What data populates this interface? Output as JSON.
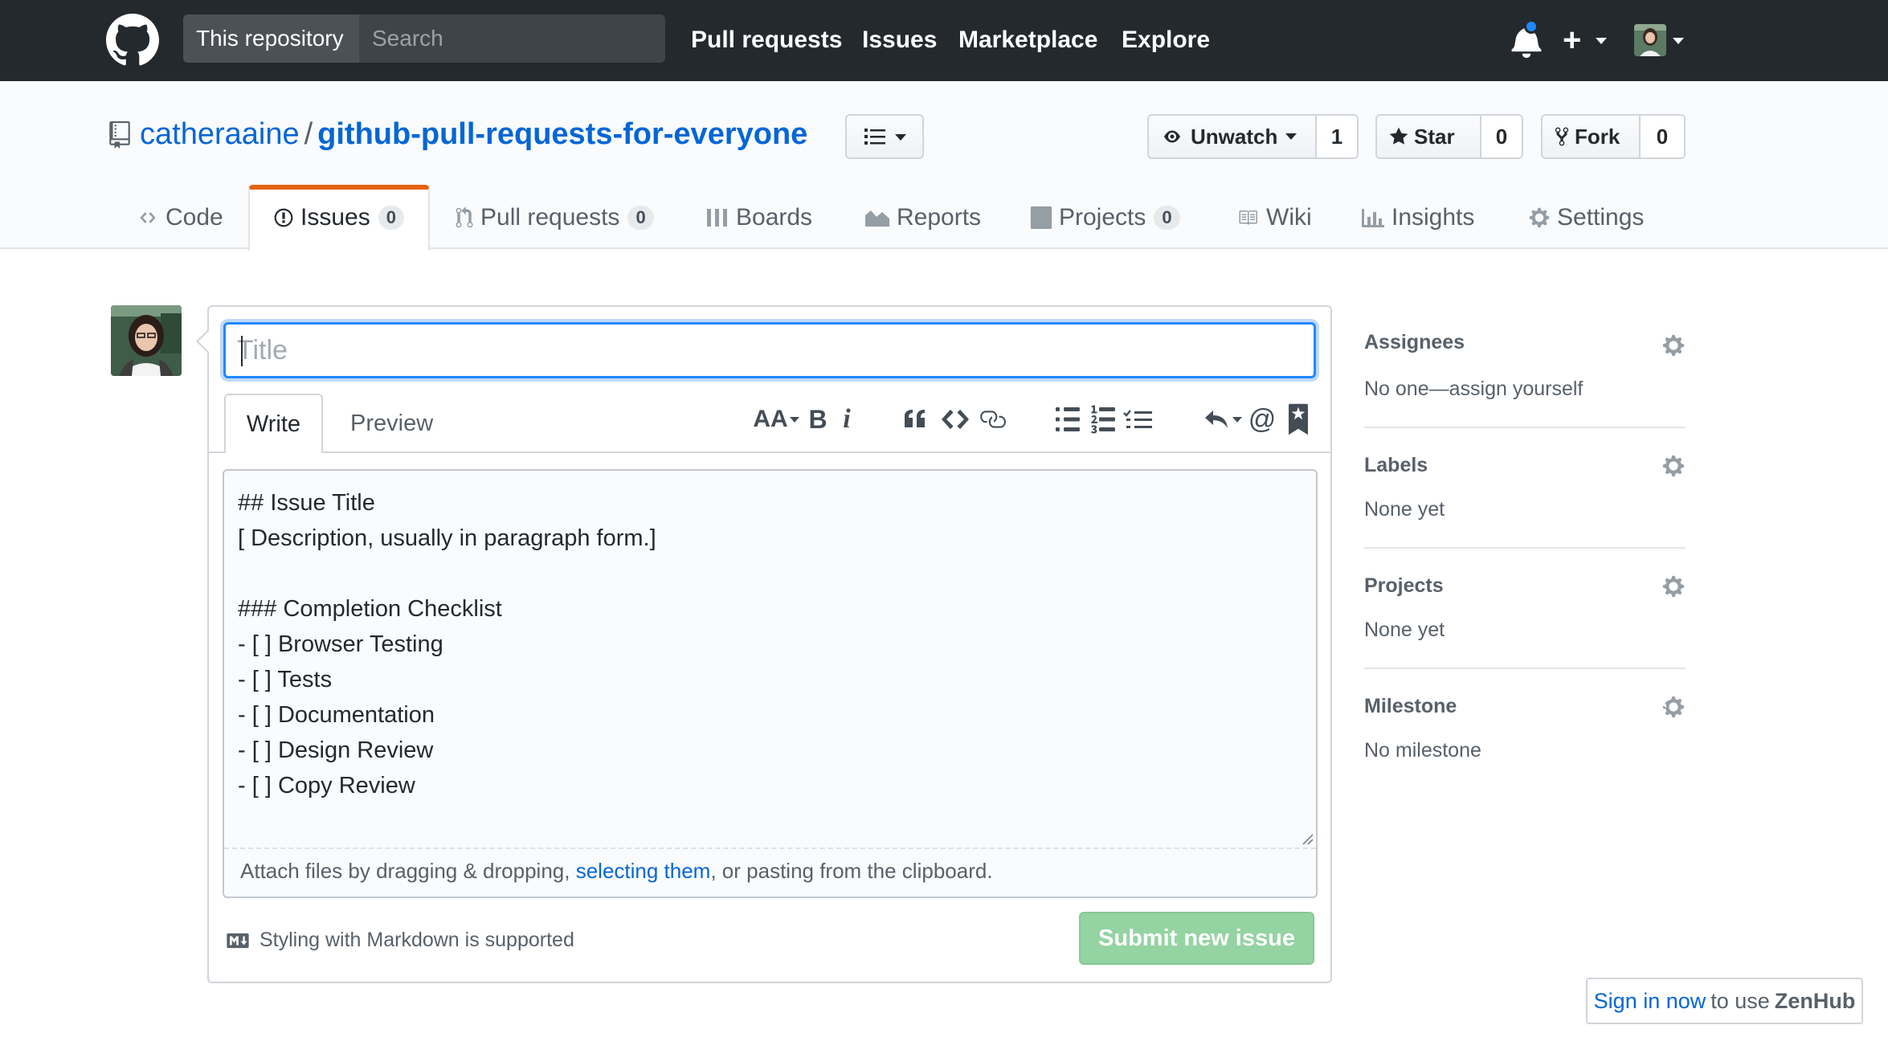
{
  "header": {
    "search_scope": "This repository",
    "search_placeholder": "Search",
    "nav": [
      "Pull requests",
      "Issues",
      "Marketplace",
      "Explore"
    ]
  },
  "repo": {
    "owner": "catheraaine",
    "separator": "/",
    "name": "github-pull-requests-for-everyone",
    "watch_label": "Unwatch",
    "watch_count": "1",
    "star_label": "Star",
    "star_count": "0",
    "fork_label": "Fork",
    "fork_count": "0"
  },
  "tabs": [
    {
      "label": "Code",
      "icon": "code-icon"
    },
    {
      "label": "Issues",
      "counter": "0",
      "icon": "issue-opened-icon",
      "selected": true
    },
    {
      "label": "Pull requests",
      "counter": "0",
      "icon": "git-pull-request-icon"
    },
    {
      "label": "Boards",
      "icon": "boards-icon"
    },
    {
      "label": "Reports",
      "icon": "graph-icon"
    },
    {
      "label": "Projects",
      "counter": "0",
      "icon": "project-icon"
    },
    {
      "label": "Wiki",
      "icon": "book-icon"
    },
    {
      "label": "Insights",
      "icon": "insights-icon"
    },
    {
      "label": "Settings",
      "icon": "gear-icon"
    }
  ],
  "editor": {
    "title_placeholder": "Title",
    "write_tab": "Write",
    "preview_tab": "Preview",
    "body_lines": [
      "## Issue Title",
      "[ Description, usually in paragraph form.]",
      "",
      "### Completion Checklist",
      "- [ ] Browser Testing",
      "- [ ] Tests",
      "- [ ] Documentation",
      "- [ ] Design Review",
      "- [ ] Copy Review"
    ],
    "attach_prefix": "Attach files by dragging & dropping, ",
    "attach_link": "selecting them",
    "attach_suffix": ", or pasting from the clipboard.",
    "markdown_note": "Styling with Markdown is supported",
    "submit_label": "Submit new issue",
    "toolbar_text_size": "AA",
    "toolbar_bold": "B",
    "toolbar_italic": "i",
    "toolbar_mention": "@"
  },
  "sidebar": {
    "assignees_label": "Assignees",
    "assignees_value": "No one—assign yourself",
    "labels_label": "Labels",
    "labels_value": "None yet",
    "projects_label": "Projects",
    "projects_value": "None yet",
    "milestone_label": "Milestone",
    "milestone_value": "No milestone"
  },
  "zenhub": {
    "link": "Sign in now",
    "middle": "to use",
    "brand": "ZenHub"
  },
  "colors": {
    "header_bg": "#24292e",
    "link": "#0366d6",
    "selected_tab_accent": "#e36209",
    "submit_disabled": "#94d3a2",
    "focus": "#2188ff"
  }
}
